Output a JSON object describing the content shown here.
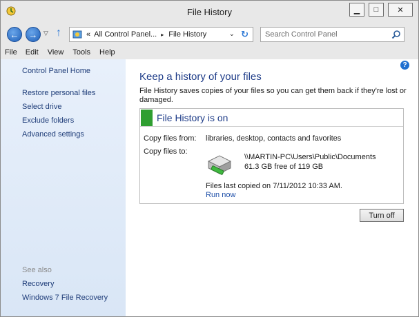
{
  "window": {
    "title": "File History",
    "minimize_glyph": "▁",
    "maximize_glyph": "□",
    "close_glyph": "✕"
  },
  "nav": {
    "back_glyph": "←",
    "forward_glyph": "→",
    "recent_glyph": "▽",
    "up_glyph": "↑",
    "address_prefix": "«",
    "breadcrumb_parent": "All Control Panel...",
    "breadcrumb_sep": "▸",
    "breadcrumb_current": "File History",
    "dropdown_glyph": "⌄",
    "refresh_glyph": "↻",
    "search_placeholder": "Search Control Panel"
  },
  "menu": [
    "File",
    "Edit",
    "View",
    "Tools",
    "Help"
  ],
  "sidebar": {
    "home": "Control Panel Home",
    "links": [
      "Restore personal files",
      "Select drive",
      "Exclude folders",
      "Advanced settings"
    ],
    "see_also_heading": "See also",
    "see_also": [
      "Recovery",
      "Windows 7 File Recovery"
    ]
  },
  "main": {
    "help_glyph": "?",
    "heading": "Keep a history of your files",
    "description": "File History saves copies of your files so you can get them back if they're lost or damaged.",
    "status": "File History is on",
    "copy_from_label": "Copy files from:",
    "copy_from_value": "libraries, desktop, contacts and favorites",
    "copy_to_label": "Copy files to:",
    "drive_path": "\\\\MARTIN-PC\\Users\\Public\\Documents",
    "drive_free": "61.3 GB free of 119 GB",
    "last_copied": "Files last copied on 7/11/2012 10:33 AM.",
    "run_now": "Run now",
    "turn_off": "Turn off"
  },
  "colors": {
    "status_green": "#2f9e31",
    "link_blue": "#1e3c78",
    "heading_blue": "#1e3c88",
    "sidebar_bg": "#e8f0fb"
  },
  "icons": {
    "app": "file-history-icon",
    "drive": "external-drive-icon",
    "search": "search-icon"
  }
}
